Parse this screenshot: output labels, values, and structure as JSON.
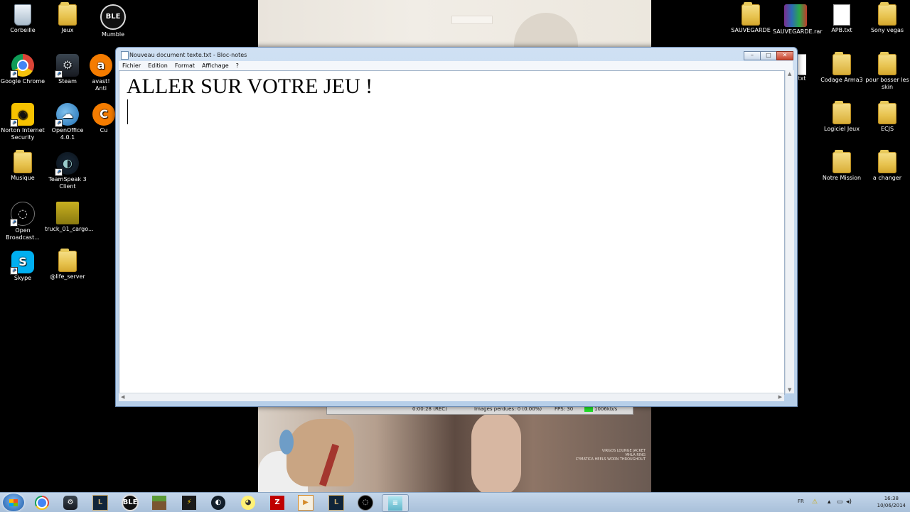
{
  "desktop": {
    "left_icons": [
      {
        "label": "Corbeille",
        "icon": "recycle-bin-icon"
      },
      {
        "label": "Jeux",
        "icon": "folder-icon"
      },
      {
        "label": "Mumble",
        "icon": "mumble-icon"
      },
      {
        "label": "Google Chrome",
        "icon": "chrome-icon"
      },
      {
        "label": "Steam",
        "icon": "steam-icon"
      },
      {
        "label": "avast! Anti",
        "icon": "avast-icon"
      },
      {
        "label": "Norton Internet Security",
        "icon": "norton-icon"
      },
      {
        "label": "OpenOffice 4.0.1",
        "icon": "openoffice-icon"
      },
      {
        "label": "Cu",
        "icon": "app-icon"
      },
      {
        "label": "Musique",
        "icon": "music-folder-icon"
      },
      {
        "label": "TeamSpeak 3 Client",
        "icon": "teamspeak-icon"
      },
      {
        "label": "Open Broadcast...",
        "icon": "obs-icon"
      },
      {
        "label": "truck_01_cargo...",
        "icon": "image-file-icon"
      },
      {
        "label": "Skype",
        "icon": "skype-icon"
      },
      {
        "label": "@life_server",
        "icon": "folder-icon"
      }
    ],
    "right_icons": [
      {
        "label": "SAUVEGARDE",
        "icon": "folder-icon"
      },
      {
        "label": "SAUVEGARDE.rar",
        "icon": "rar-archive-icon"
      },
      {
        "label": "APB.txt",
        "icon": "text-file-icon"
      },
      {
        "label": "Sony vegas",
        "icon": "folder-icon"
      },
      {
        "label": ".txt",
        "icon": "text-file-icon"
      },
      {
        "label": "Codage Arma3",
        "icon": "document-folder-icon"
      },
      {
        "label": "pour bosser les skin",
        "icon": "folder-icon"
      },
      {
        "label": "Logiciel Jeux",
        "icon": "document-folder-icon"
      },
      {
        "label": "ECJS",
        "icon": "folder-icon"
      },
      {
        "label": "Notre Mission",
        "icon": "document-folder-icon"
      },
      {
        "label": "a changer",
        "icon": "folder-icon"
      }
    ]
  },
  "wallpaper": {
    "caption_lines": [
      "VIRGOS LOUNGE JACKET",
      "MHLA RING",
      "CYMATICA HEELS WORN THROUGHOUT"
    ]
  },
  "recording_bar": {
    "time": "0:00:28 (REC)",
    "dropped": "Images perdues: 0 (0.00%)",
    "fps": "FPS: 30",
    "bitrate": "1006kb/s",
    "status_color": "#23e02a"
  },
  "notepad": {
    "title": "Nouveau document texte.txt - Bloc-notes",
    "menu": [
      "Fichier",
      "Edition",
      "Format",
      "Affichage",
      "?"
    ],
    "content": "ALLER SUR VOTRE JEU !",
    "buttons": {
      "minimize": "–",
      "maximize": "□",
      "close": "✕"
    }
  },
  "taskbar": {
    "pinned": [
      {
        "icon": "chrome-icon"
      },
      {
        "icon": "steam-icon"
      },
      {
        "icon": "league-of-legends-icon"
      },
      {
        "icon": "mumble-icon"
      },
      {
        "icon": "minecraft-icon"
      },
      {
        "icon": "lightning-app-icon"
      },
      {
        "icon": "teamspeak-icon"
      },
      {
        "icon": "yellow-app-icon"
      },
      {
        "icon": "filezilla-icon"
      },
      {
        "icon": "media-player-icon"
      },
      {
        "icon": "league-of-legends-icon"
      },
      {
        "icon": "obs-icon"
      },
      {
        "icon": "notepad-icon"
      }
    ],
    "tray": {
      "language": "FR",
      "time": "16:38",
      "date": "10/06/2014"
    }
  }
}
